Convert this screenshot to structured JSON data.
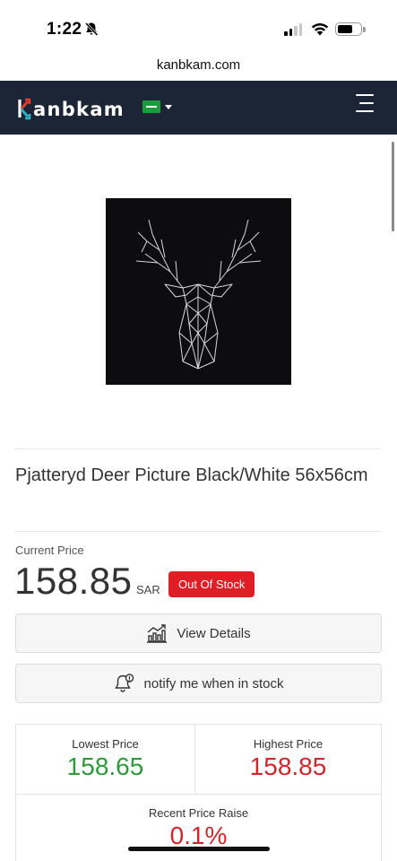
{
  "status_bar": {
    "time": "1:22"
  },
  "browser": {
    "url": "kanbkam.com"
  },
  "header": {
    "logo": "kanbkam",
    "flag_country": "Saudi Arabia"
  },
  "product": {
    "title": "Pjatteryd Deer Picture Black/White 56x56cm",
    "image_alt": "Deer head line art picture"
  },
  "pricing": {
    "current_label": "Current Price",
    "current_price": "158.85",
    "currency": "SAR",
    "stock_status": "Out Of Stock"
  },
  "actions": {
    "view_details": "View Details",
    "notify": "notify me when in stock"
  },
  "stats": {
    "lowest_label": "Lowest Price",
    "lowest_value": "158.65",
    "highest_label": "Highest Price",
    "highest_value": "158.85",
    "raise_label": "Recent Price Raise",
    "raise_value": "0.1%"
  },
  "colors": {
    "header_bg": "#1c2535",
    "badge_red": "#e01e26",
    "green": "#2e9b3a",
    "red": "#d1262b"
  }
}
